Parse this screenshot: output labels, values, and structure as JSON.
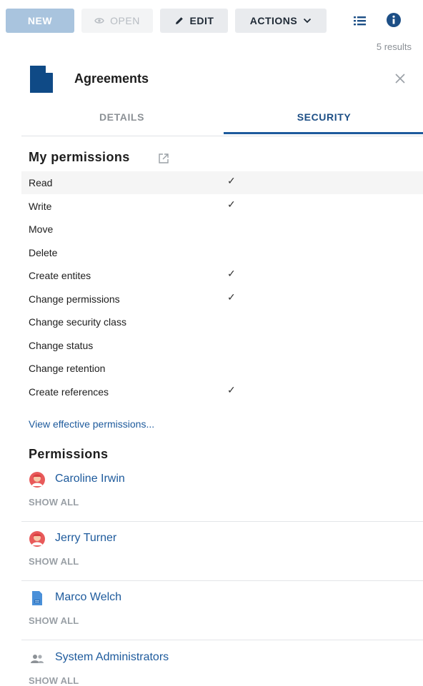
{
  "toolbar": {
    "new_label": "NEW",
    "open_label": "OPEN",
    "edit_label": "EDIT",
    "actions_label": "ACTIONS"
  },
  "results": "5 results",
  "panel": {
    "title": "Agreements",
    "tabs": [
      {
        "label": "DETAILS",
        "active": false
      },
      {
        "label": "SECURITY",
        "active": true
      }
    ]
  },
  "my_permissions": {
    "heading": "My permissions",
    "items": [
      {
        "label": "Read",
        "check": "✓"
      },
      {
        "label": "Write",
        "check": "✓"
      },
      {
        "label": "Move",
        "check": ""
      },
      {
        "label": "Delete",
        "check": ""
      },
      {
        "label": "Create entites",
        "check": "✓"
      },
      {
        "label": "Change permissions",
        "check": "✓"
      },
      {
        "label": "Change security class",
        "check": ""
      },
      {
        "label": "Change status",
        "check": ""
      },
      {
        "label": "Change retention",
        "check": ""
      },
      {
        "label": "Create references",
        "check": "✓"
      }
    ],
    "link": "View effective permissions..."
  },
  "permissions": {
    "heading": "Permissions",
    "entries": [
      {
        "name": "Caroline Irwin",
        "show_all": "SHOW ALL",
        "icon": "user-avatar-icon"
      },
      {
        "name": "Jerry Turner",
        "show_all": "SHOW ALL",
        "icon": "user-avatar-icon"
      },
      {
        "name": "Marco Welch",
        "show_all": "SHOW ALL",
        "icon": "id-card-icon"
      },
      {
        "name": "System Administrators",
        "show_all": "SHOW ALL",
        "icon": "group-icon"
      }
    ]
  },
  "colors": {
    "accent": "#1d5a9c",
    "primary_button": "#a9c4de",
    "text_muted": "#9aa0a6"
  }
}
